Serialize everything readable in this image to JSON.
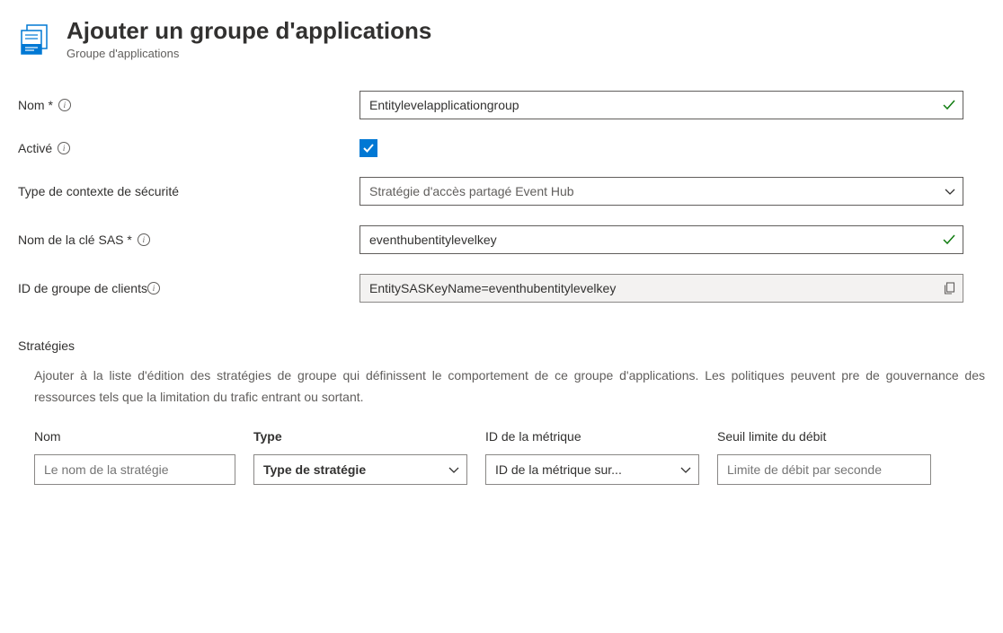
{
  "header": {
    "title": "Ajouter un groupe d'applications",
    "subtitle": "Groupe d'applications"
  },
  "form": {
    "name_label": "Nom *",
    "name_value": "Entitylevelapplicationgroup",
    "enabled_label": "Activé",
    "context_label": "Type de contexte de sécurité",
    "context_value": "Stratégie d'accès partagé Event Hub",
    "saskey_label": "Nom de la clé SAS *",
    "saskey_value": "eventhubentitylevelkey",
    "clientgroup_label": "ID de groupe de clients",
    "clientgroup_value": "EntitySASKeyName=eventhubentitylevelkey"
  },
  "policies": {
    "section_label": "Stratégies",
    "description": "Ajouter à la liste d'édition des stratégies de groupe qui définissent le comportement de ce groupe d'applications. Les politiques peuvent pre de gouvernance des ressources tels que la limitation du trafic entrant ou sortant.",
    "cols": {
      "name": "Nom",
      "type": "Type",
      "metric": "ID de la métrique",
      "rate": "Seuil limite du débit"
    },
    "placeholders": {
      "name": "Le nom de la stratégie",
      "type": "Type de stratégie",
      "metric": "ID de la métrique sur...",
      "rate": "Limite de débit par seconde"
    }
  }
}
